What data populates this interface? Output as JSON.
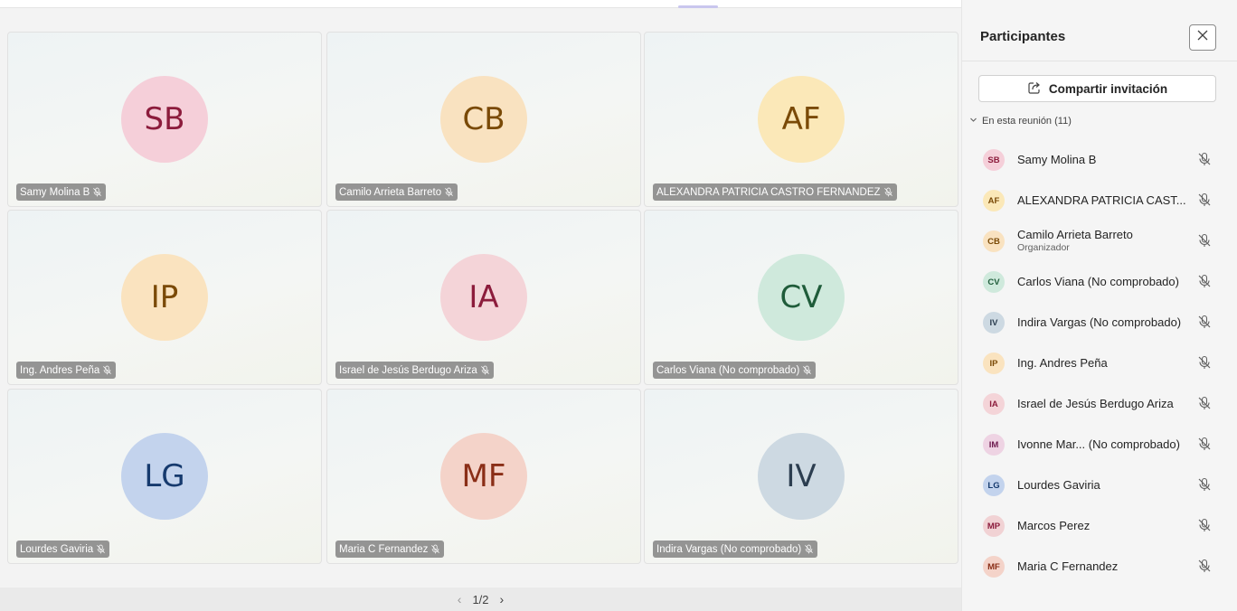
{
  "stage": {
    "tiles": [
      {
        "initials": "SB",
        "name": "Samy Molina B",
        "bg": "#f5cfd9",
        "fg": "#8c1c3c"
      },
      {
        "initials": "CB",
        "name": "Camilo Arrieta Barreto",
        "bg": "#f9e2c0",
        "fg": "#7a4a07"
      },
      {
        "initials": "AF",
        "name": "ALEXANDRA PATRICIA CASTRO FERNANDEZ",
        "bg": "#fbe8b8",
        "fg": "#7a4a07"
      },
      {
        "initials": "IP",
        "name": "Ing. Andres Peña",
        "bg": "#fae3bf",
        "fg": "#7a4a07"
      },
      {
        "initials": "IA",
        "name": "Israel de Jesús Berdugo Ariza",
        "bg": "#f4d4d8",
        "fg": "#8c1c3c"
      },
      {
        "initials": "CV",
        "name": "Carlos Viana (No comprobado)",
        "bg": "#cfe9dc",
        "fg": "#1f5c3a"
      },
      {
        "initials": "LG",
        "name": "Lourdes Gaviria",
        "bg": "#c3d3ed",
        "fg": "#163a6e"
      },
      {
        "initials": "MF",
        "name": "Maria C Fernandez",
        "bg": "#f4d3c9",
        "fg": "#8a2e17"
      },
      {
        "initials": "IV",
        "name": "Indira Vargas (No comprobado)",
        "bg": "#cdd9e2",
        "fg": "#2c3e50"
      }
    ],
    "pager": {
      "prev_icon": "chevron-left-icon",
      "label": "1/2",
      "next_icon": "chevron-right-icon"
    }
  },
  "panel": {
    "title": "Participantes",
    "close_icon": "close-icon",
    "share_label": "Compartir invitación",
    "share_icon": "share-icon",
    "section_label": "En esta reunión (11)",
    "participants": [
      {
        "initials": "SB",
        "name": "Samy Molina B",
        "role": "",
        "bg": "#f5cfd9",
        "fg": "#8c1c3c"
      },
      {
        "initials": "AF",
        "name": "ALEXANDRA PATRICIA CAST...",
        "role": "",
        "bg": "#fbe8b8",
        "fg": "#7a4a07"
      },
      {
        "initials": "CB",
        "name": "Camilo Arrieta Barreto",
        "role": "Organizador",
        "bg": "#f9e2c0",
        "fg": "#7a4a07"
      },
      {
        "initials": "CV",
        "name": "Carlos Viana (No comprobado)",
        "role": "",
        "bg": "#cfe9dc",
        "fg": "#1f5c3a"
      },
      {
        "initials": "IV",
        "name": "Indira Vargas (No comprobado)",
        "role": "",
        "bg": "#cdd9e2",
        "fg": "#2c3e50"
      },
      {
        "initials": "IP",
        "name": "Ing. Andres Peña",
        "role": "",
        "bg": "#fae3bf",
        "fg": "#7a4a07"
      },
      {
        "initials": "IA",
        "name": "Israel de Jesús Berdugo Ariza",
        "role": "",
        "bg": "#f4d4d8",
        "fg": "#8c1c3c"
      },
      {
        "initials": "IM",
        "name": "Ivonne Mar...  (No comprobado)",
        "role": "",
        "bg": "#eed3e3",
        "fg": "#6e1b4f"
      },
      {
        "initials": "LG",
        "name": "Lourdes Gaviria",
        "role": "",
        "bg": "#c3d3ed",
        "fg": "#163a6e"
      },
      {
        "initials": "MP",
        "name": "Marcos Perez",
        "role": "",
        "bg": "#f1d2d4",
        "fg": "#8c1c3c"
      },
      {
        "initials": "MF",
        "name": "Maria C Fernandez",
        "role": "",
        "bg": "#f4d3c9",
        "fg": "#8a2e17"
      }
    ]
  }
}
